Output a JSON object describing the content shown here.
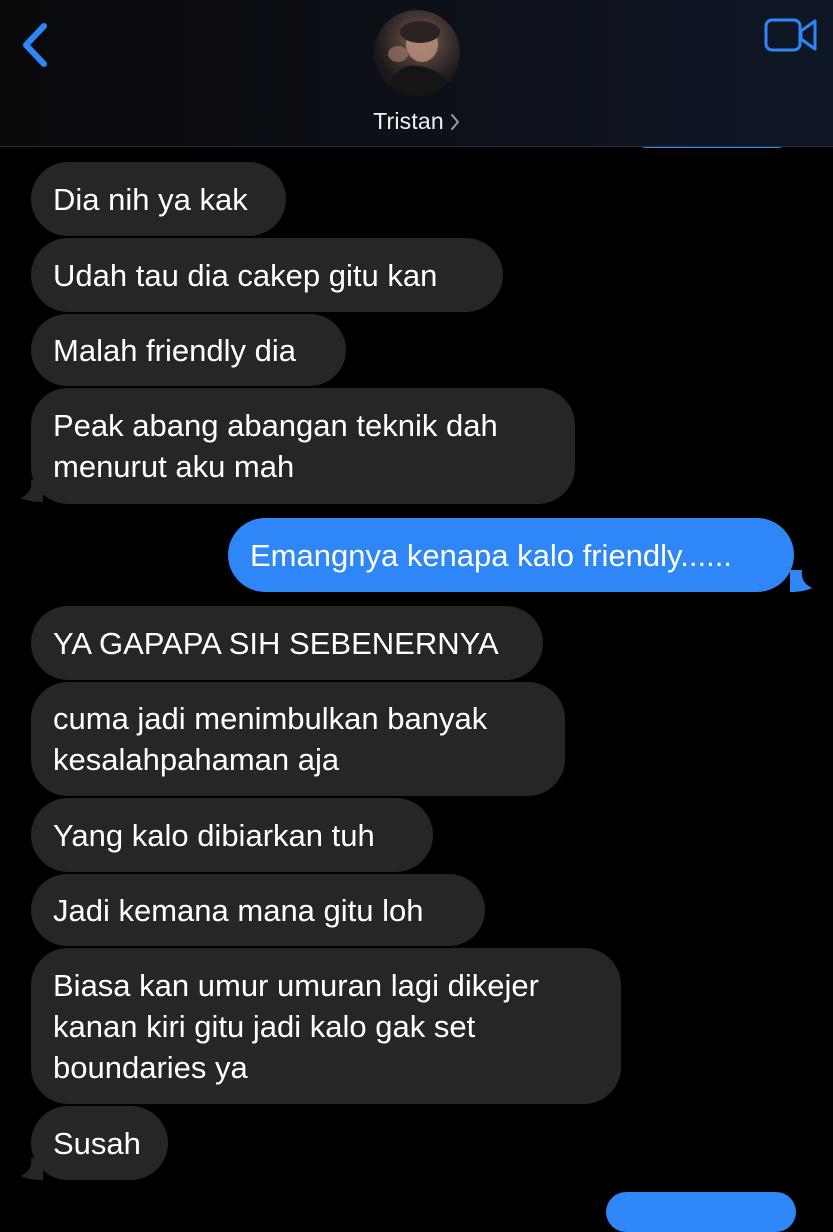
{
  "header": {
    "contact_name": "Tristan",
    "avatar": "avatar",
    "icons": {
      "back": "chevron-left-icon",
      "disclosure": "chevron-right-icon",
      "video": "video-camera-icon"
    },
    "colors": {
      "accent": "#2f86f6",
      "incoming_bubble": "#262629",
      "background": "#000000"
    }
  },
  "messages": [
    {
      "direction": "incoming",
      "text": "Dia nih ya kak"
    },
    {
      "direction": "incoming",
      "text": "Udah tau dia cakep gitu kan"
    },
    {
      "direction": "incoming",
      "text": "Malah friendly dia"
    },
    {
      "direction": "incoming",
      "lines": [
        "Peak abang abangan teknik dah",
        "menurut aku mah"
      ]
    },
    {
      "direction": "outgoing",
      "text": "Emangnya kenapa kalo friendly......"
    },
    {
      "direction": "incoming",
      "text": "YA GAPAPA SIH SEBENERNYA"
    },
    {
      "direction": "incoming",
      "lines": [
        "cuma jadi menimbulkan banyak",
        "kesalahpahaman aja"
      ]
    },
    {
      "direction": "incoming",
      "text": "Yang kalo dibiarkan tuh"
    },
    {
      "direction": "incoming",
      "text": "Jadi kemana mana gitu loh"
    },
    {
      "direction": "incoming",
      "lines": [
        "Biasa kan umur umuran lagi dikejer",
        "kanan kiri gitu jadi kalo gak set",
        "boundaries ya"
      ]
    },
    {
      "direction": "incoming",
      "text": "Susah"
    }
  ]
}
